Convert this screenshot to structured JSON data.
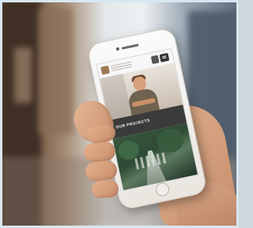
{
  "image": {
    "subject": "",
    "phone_screen": {
      "banner_text": "OUR PROJECTS"
    }
  }
}
